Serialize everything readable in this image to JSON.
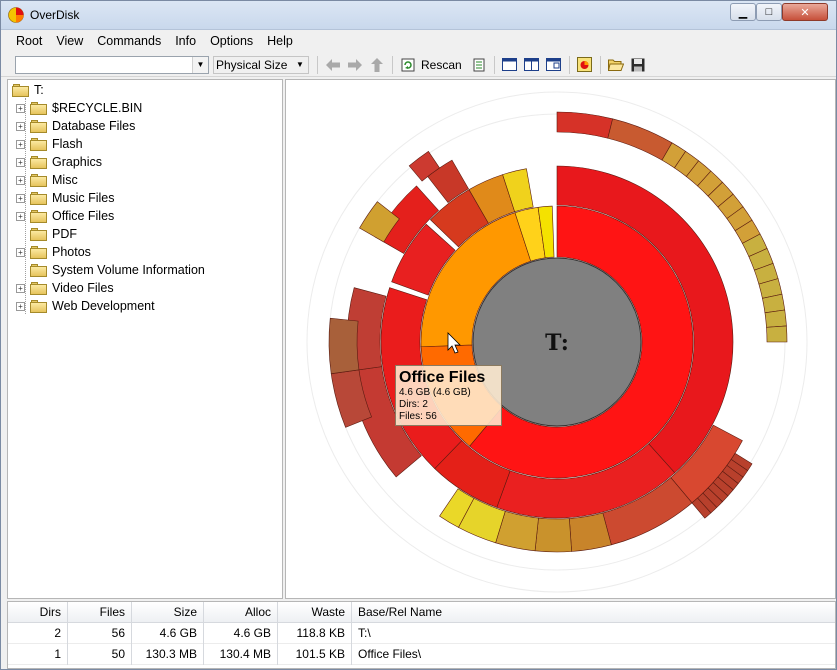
{
  "window": {
    "title": "OverDisk"
  },
  "menu": [
    "Root",
    "View",
    "Commands",
    "Info",
    "Options",
    "Help"
  ],
  "toolbar": {
    "path_value": "",
    "size_mode": "Physical Size",
    "rescan_label": "Rescan"
  },
  "tree": {
    "root": "T:",
    "items": [
      {
        "label": "$RECYCLE.BIN",
        "expandable": true
      },
      {
        "label": "Database Files",
        "expandable": true
      },
      {
        "label": "Flash",
        "expandable": true
      },
      {
        "label": "Graphics",
        "expandable": true
      },
      {
        "label": "Misc",
        "expandable": true
      },
      {
        "label": "Music Files",
        "expandable": true
      },
      {
        "label": "Office Files",
        "expandable": true
      },
      {
        "label": "PDF",
        "expandable": false
      },
      {
        "label": "Photos",
        "expandable": true
      },
      {
        "label": "System Volume Information",
        "expandable": false
      },
      {
        "label": "Video Files",
        "expandable": true
      },
      {
        "label": "Web Development",
        "expandable": true
      }
    ]
  },
  "chart": {
    "center_label": "T:",
    "tooltip": {
      "name": "Office Files",
      "size": "4.6 GB (4.6 GB)",
      "dirs": "Dirs: 2",
      "files": "Files: 56"
    }
  },
  "list": {
    "headers": [
      "Dirs",
      "Files",
      "Size",
      "Alloc",
      "Waste",
      "Base/Rel Name"
    ],
    "rows": [
      [
        "2",
        "56",
        "4.6 GB",
        "4.6 GB",
        "118.8 KB",
        "T:\\"
      ],
      [
        "1",
        "50",
        "130.3 MB",
        "130.4 MB",
        "101.5 KB",
        "Office Files\\"
      ]
    ]
  }
}
